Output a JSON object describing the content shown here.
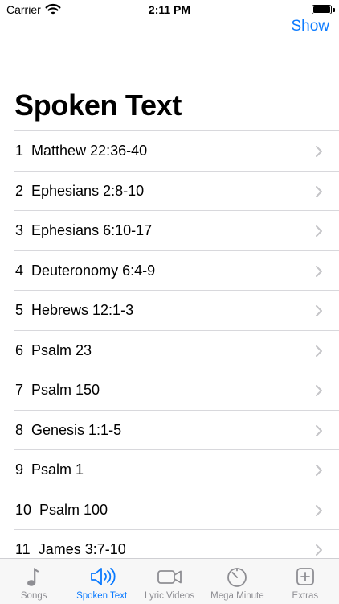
{
  "status_bar": {
    "carrier": "Carrier",
    "time": "2:11 PM"
  },
  "nav": {
    "action_label": "Show"
  },
  "page": {
    "title": "Spoken Text"
  },
  "list": {
    "items": [
      {
        "label": "1  Matthew 22:36-40"
      },
      {
        "label": "2  Ephesians 2:8-10"
      },
      {
        "label": "3  Ephesians 6:10-17"
      },
      {
        "label": "4  Deuteronomy 6:4-9"
      },
      {
        "label": "5  Hebrews 12:1-3"
      },
      {
        "label": "6  Psalm 23"
      },
      {
        "label": "7  Psalm 150"
      },
      {
        "label": "8  Genesis 1:1-5"
      },
      {
        "label": "9  Psalm 1"
      },
      {
        "label": "10  Psalm 100"
      },
      {
        "label": "11  James 3:7-10"
      }
    ]
  },
  "tabs": [
    {
      "label": "Songs",
      "icon": "music-note-icon",
      "active": false
    },
    {
      "label": "Spoken Text",
      "icon": "speaker-wave-icon",
      "active": true
    },
    {
      "label": "Lyric Videos",
      "icon": "video-camera-icon",
      "active": false
    },
    {
      "label": "Mega Minute",
      "icon": "timer-icon",
      "active": false
    },
    {
      "label": "Extras",
      "icon": "plus-square-icon",
      "active": false
    }
  ],
  "colors": {
    "accent": "#0a7aff",
    "inactive": "#8e8e93",
    "separator": "#d8d8dc",
    "chevron": "#c4c4c7"
  }
}
